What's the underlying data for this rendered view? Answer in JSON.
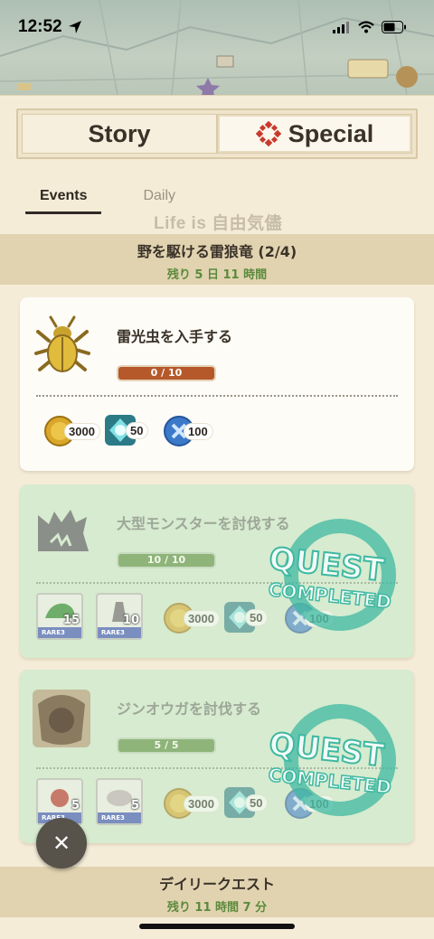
{
  "status_bar": {
    "time": "12:52"
  },
  "tabs": {
    "story": "Story",
    "special": "Special"
  },
  "subtabs": {
    "events": "Events",
    "daily": "Daily"
  },
  "watermark": "Life is 自由気儘",
  "event_band": {
    "title": "野を駆ける雷狼竜 (2/4)",
    "remaining": "残り 5 日 11 時間"
  },
  "quests": [
    {
      "title": "雷光虫を入手する",
      "progress_text": "0 / 10",
      "progress_fraction": 0.0,
      "completed": false,
      "rewards": [
        {
          "icon": "coin-icon",
          "count": "3000"
        },
        {
          "icon": "gem-icon",
          "count": "50"
        },
        {
          "icon": "blue-token-icon",
          "count": "100"
        }
      ]
    },
    {
      "title": "大型モンスターを討伐する",
      "progress_text": "10 / 10",
      "progress_fraction": 1.0,
      "completed": true,
      "items": [
        {
          "icon": "material-icon",
          "tag": "RARE3",
          "count": "15"
        },
        {
          "icon": "material-icon",
          "tag": "RARE3",
          "count": "10"
        }
      ],
      "rewards": [
        {
          "icon": "coin-icon",
          "count": "3000"
        },
        {
          "icon": "gem-icon",
          "count": "50"
        },
        {
          "icon": "blue-token-icon",
          "count": "100"
        }
      ]
    },
    {
      "title": "ジンオウガを討伐する",
      "progress_text": "5 / 5",
      "progress_fraction": 1.0,
      "completed": true,
      "items": [
        {
          "icon": "material-icon",
          "tag": "RARE3",
          "count": "5"
        },
        {
          "icon": "material-icon",
          "tag": "RARE3",
          "count": "5"
        }
      ],
      "rewards": [
        {
          "icon": "coin-icon",
          "count": "3000"
        },
        {
          "icon": "gem-icon",
          "count": "50"
        },
        {
          "icon": "blue-token-icon",
          "count": "100"
        }
      ]
    }
  ],
  "stamp": {
    "line1": "QUEST",
    "line2": "COMPLETED"
  },
  "daily_band": {
    "title": "デイリークエスト",
    "remaining": "残り 11 時間 7 分"
  },
  "colors": {
    "progress_empty": "#b5592a",
    "progress_full": "#8fb47a",
    "remaining_green": "#5b8a3c",
    "stamp_teal": "#3fb8a2"
  }
}
